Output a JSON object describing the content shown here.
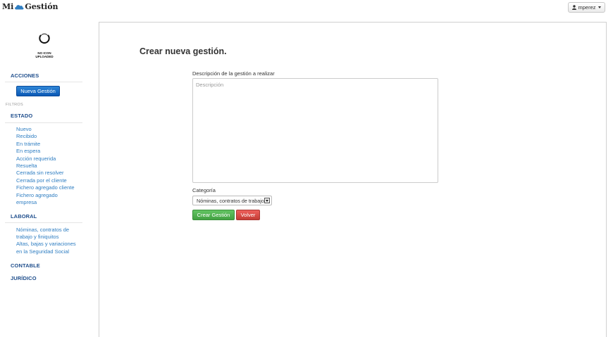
{
  "header": {
    "brand_left": "Mi",
    "brand_right": "Gestión",
    "user_label": "mperez"
  },
  "sidebar": {
    "logo_text_line1": "NO ICON",
    "logo_text_line2": "UPLOADED",
    "acciones": "ACCIONES",
    "new_button": "Nueva Gestión",
    "filtros": "FILTROS",
    "estado": "ESTADO",
    "estado_items": [
      "Nuevo",
      "Recibido",
      "En trámite",
      "En espera",
      "Acción requerida",
      "Resuelta",
      "Cerrada sin resolver",
      "Cerrada por el cliente",
      "Fichero agregado cliente",
      "Fichero agregado",
      "empresa"
    ],
    "laboral": "LABORAL",
    "laboral_items": [
      "Nóminas, contratos de",
      "trabajo y finiquitos",
      "Altas, bajas y variaciones",
      "en la Seguridad Social"
    ],
    "contable": "CONTABLE",
    "juridico": "JURÍDICO"
  },
  "form": {
    "title": "Crear nueva gestión.",
    "desc_label": "Descripción de la gestión a realizar",
    "desc_placeholder": "Descripción",
    "cat_label": "Categoría",
    "cat_value": "Nóminas, contratos de trabajo y finiquitos",
    "create_button": "Crear Gestión",
    "back_button": "Volver"
  },
  "colors": {
    "link": "#2f7ec2",
    "section_head": "#1f4e8c",
    "primary": "#0a58b5",
    "success": "#42a142",
    "danger": "#c43c35"
  }
}
